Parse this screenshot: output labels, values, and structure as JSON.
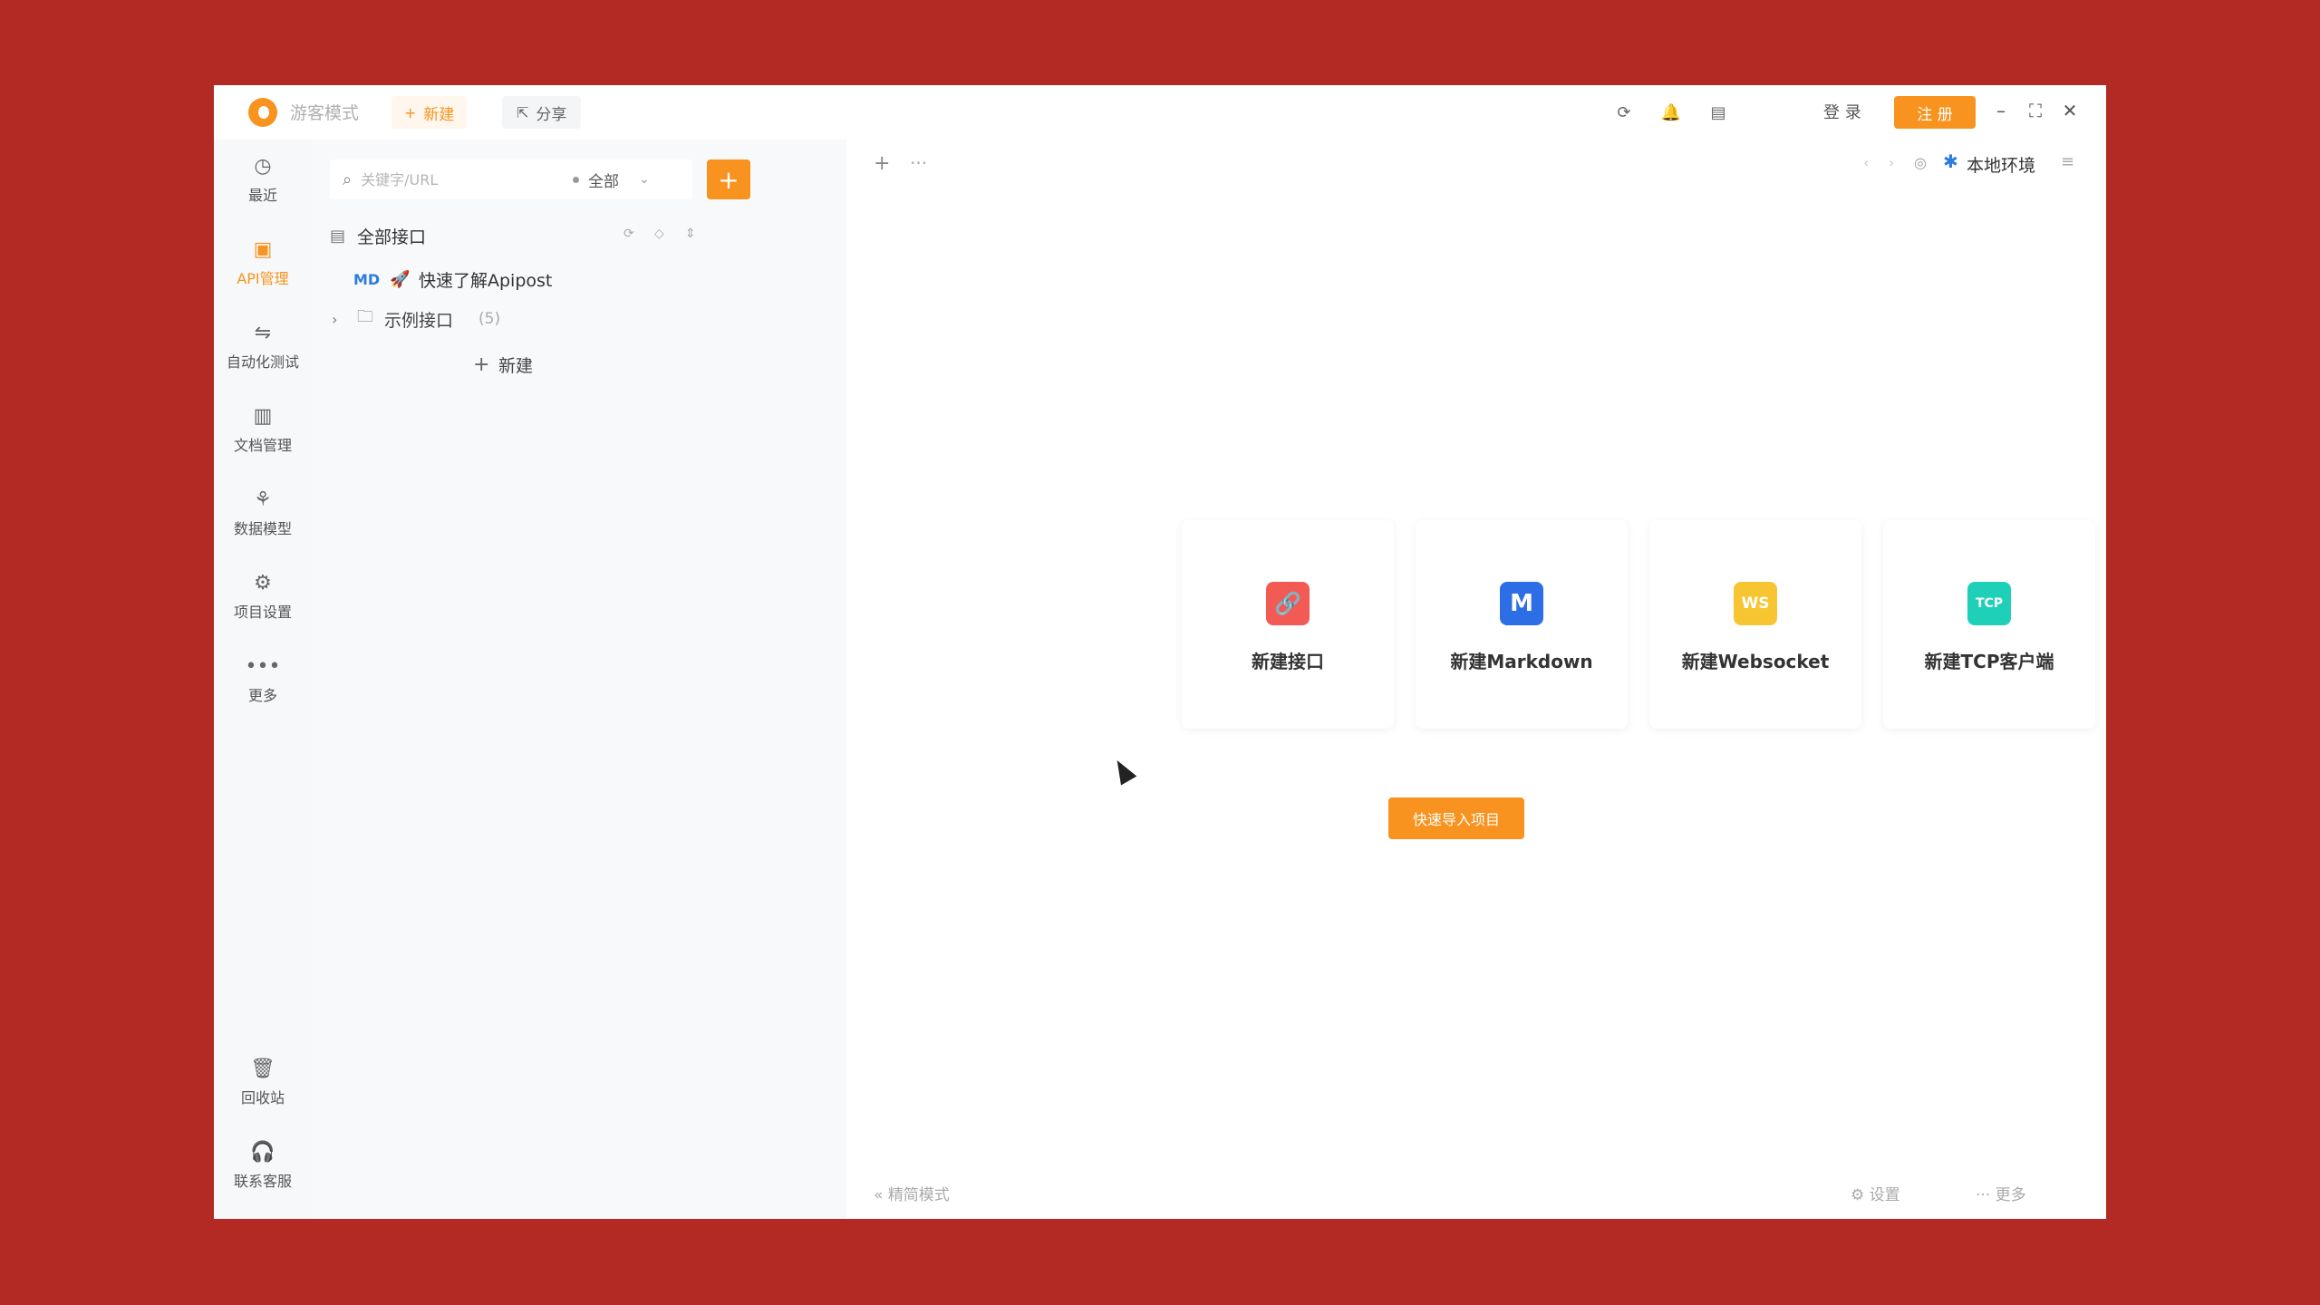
{
  "topbar": {
    "mode": "游客模式",
    "new_label": "新建",
    "share_label": "分享",
    "login": "登 录",
    "register": "注 册"
  },
  "rail": {
    "items": [
      {
        "label": "最近",
        "icon": "clock-icon"
      },
      {
        "label": "API管理",
        "icon": "api-icon",
        "active": true
      },
      {
        "label": "自动化测试",
        "icon": "flow-icon"
      },
      {
        "label": "文档管理",
        "icon": "doc-icon"
      },
      {
        "label": "数据模型",
        "icon": "model-icon"
      },
      {
        "label": "项目设置",
        "icon": "settings-icon"
      },
      {
        "label": "更多",
        "icon": "more-icon"
      }
    ],
    "bottom": [
      {
        "label": "回收站",
        "icon": "trash-icon"
      },
      {
        "label": "联系客服",
        "icon": "headset-icon"
      }
    ]
  },
  "tree": {
    "search_placeholder": "关键字/URL",
    "filter": "全部",
    "all_label": "全部接口",
    "md_badge": "MD",
    "md_item": "快速了解Apipost",
    "folder_label": "示例接口",
    "folder_count": "(5)",
    "new_label": "新建"
  },
  "main": {
    "env": "本地环境",
    "cards": [
      {
        "label": "新建接口",
        "icon_text": "🔗",
        "color": "#f25a54"
      },
      {
        "label": "新建Markdown",
        "icon_text": "M",
        "color": "#2d6ee6"
      },
      {
        "label": "新建Websocket",
        "icon_text": "WS",
        "color": "#f7c531"
      },
      {
        "label": "新建TCP客户端",
        "icon_text": "TCP",
        "color": "#1fd0b8"
      }
    ],
    "import_label": "快速导入项目",
    "footer_left": "精简模式",
    "footer_settings": "设置",
    "footer_more": "更多"
  },
  "colors": {
    "accent": "#f7931e",
    "background": "#b22a23"
  }
}
